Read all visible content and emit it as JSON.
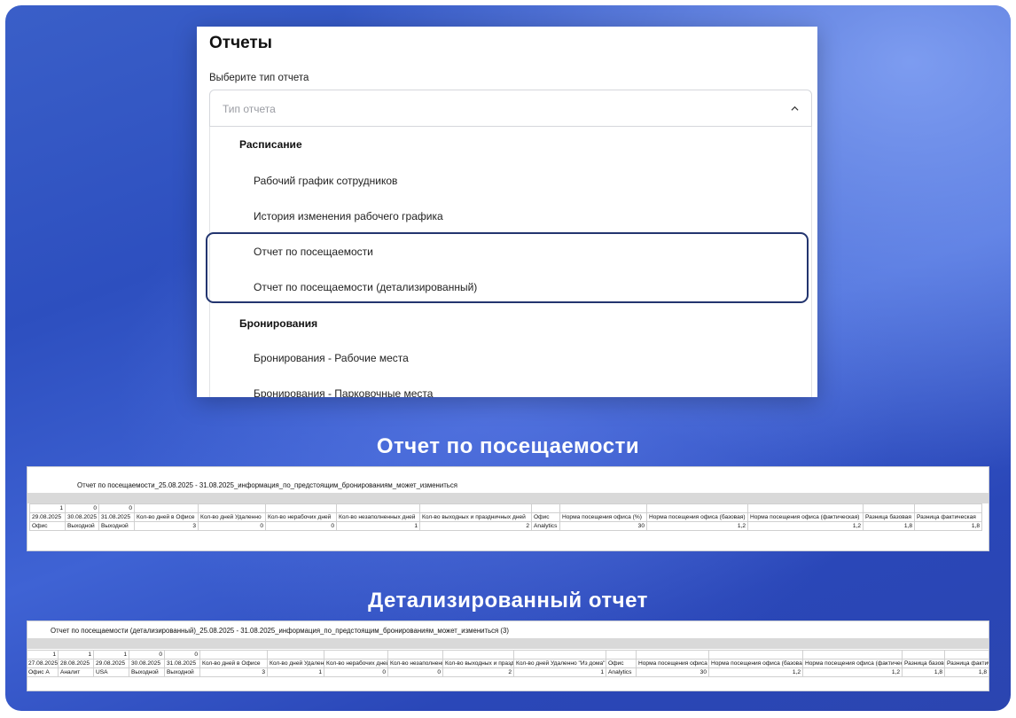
{
  "dropdown": {
    "title": "Отчеты",
    "field_label": "Выберите тип отчета",
    "placeholder": "Тип отчета",
    "groups": [
      {
        "label": "Расписание",
        "items": [
          "Рабочий график сотрудников",
          "История изменения рабочего графика",
          "Отчет по посещаемости",
          "Отчет по посещаемости (детализированный)"
        ]
      },
      {
        "label": "Бронирования",
        "items": [
          "Бронирования - Рабочие места",
          "Бронирования - Парковочные места"
        ]
      }
    ]
  },
  "attendance": {
    "heading": "Отчет по посещаемости",
    "sheet_title": "Отчет по посещаемости_25.08.2025 - 31.08.2025_информация_по_предстоящим_бронированиям_может_измениться",
    "rows": [
      [
        "1",
        "0",
        "0",
        "",
        "",
        "",
        "",
        "",
        "",
        "",
        "",
        "",
        "",
        "",
        ""
      ],
      [
        "29.08.2025",
        "30.08.2025",
        "31.08.2025",
        "Кол-во дней в Офисе",
        "Кол-во дней Удаленно",
        "Кол-во нерабочих дней",
        "Кол-во незаполненных дней",
        "Кол-во выходных и праздничных дней",
        "Офис",
        "Норма посещения офиса (%)",
        "Норма посещения офиса (базовая)",
        "Норма посещения офиса (фактическая)",
        "Разница базовая",
        "Разница фактическая"
      ],
      [
        "Офис",
        "Выходной",
        "Выходной",
        "3",
        "0",
        "0",
        "1",
        "2",
        "Analytics",
        "30",
        "1,2",
        "1,2",
        "1,8",
        "1,8"
      ]
    ]
  },
  "detailed": {
    "heading": "Детализированный отчет",
    "sheet_title": "Отчет по посещаемости (детализированный)_25.08.2025 - 31.08.2025_информация_по_предстоящим_бронированиям_может_измениться (3)",
    "rows": [
      [
        "1",
        "1",
        "1",
        "0",
        "0",
        "",
        "",
        "",
        "",
        "",
        "",
        "",
        "",
        "",
        "",
        "",
        "",
        ""
      ],
      [
        "27.08.2025",
        "28.08.2025",
        "29.08.2025",
        "30.08.2025",
        "31.08.2025",
        "Кол-во дней в Офисе",
        "Кол-во дней Удаленно",
        "Кол-во нерабочих дней",
        "Кол-во незаполненных дней",
        "Кол-во выходных и праздничных дней",
        "Кол-во дней Удаленно \"Из дома\"",
        "Офис",
        "Норма посещения офиса (%)",
        "Норма посещения офиса (базовая)",
        "Норма посещения офиса (фактическая)",
        "Разница базовая",
        "Разница фактическая"
      ],
      [
        "Офис А",
        "Аналит",
        "USA",
        "Выходной",
        "Выходной",
        "3",
        "1",
        "0",
        "0",
        "2",
        "1",
        "Analytics",
        "30",
        "1,2",
        "1,2",
        "1,8",
        "1,8"
      ]
    ]
  }
}
